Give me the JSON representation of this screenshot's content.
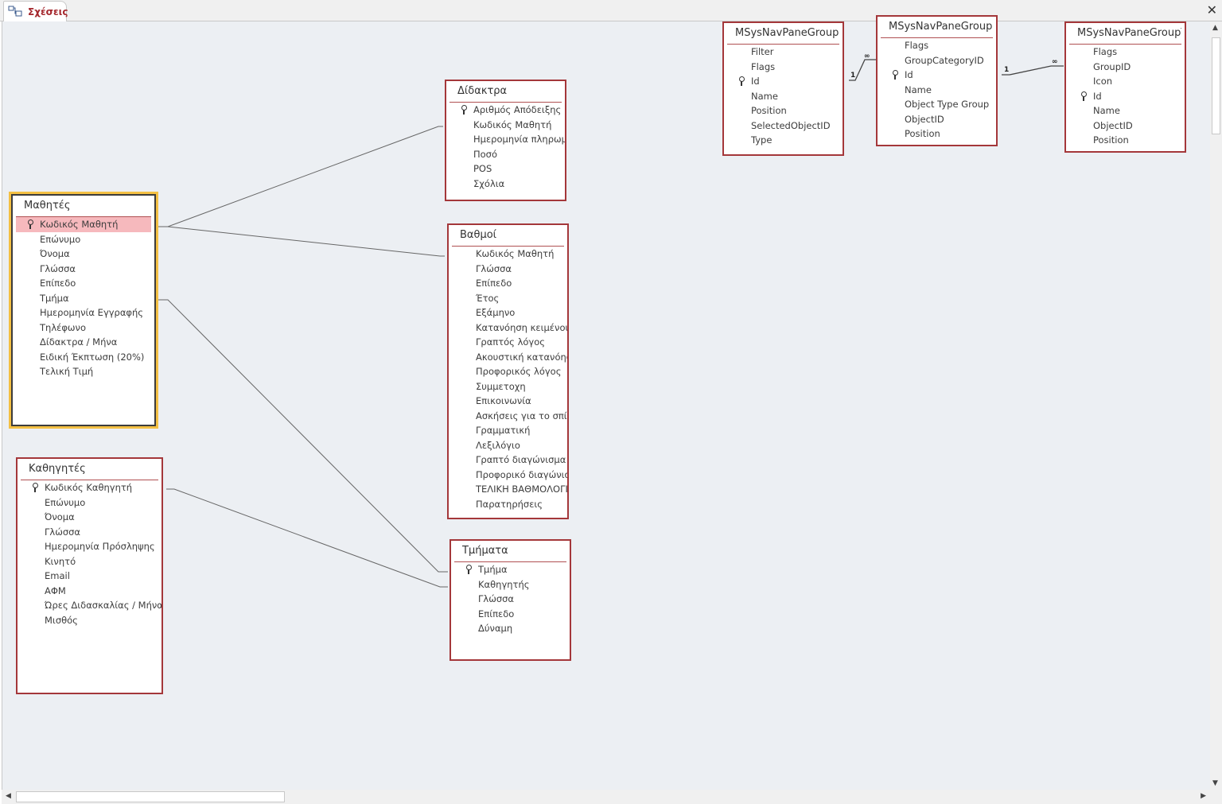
{
  "tab": {
    "label": "Σχέσεις"
  },
  "tables": {
    "mathites": {
      "title": "Μαθητές",
      "fields": [
        "Κωδικός Μαθητή",
        "Επώνυμο",
        "Όνομα",
        "Γλώσσα",
        "Επίπεδο",
        "Τμήμα",
        "Ημερομηνία Εγγραφής",
        "Τηλέφωνο",
        "Δίδακτρα / Μήνα",
        "Ειδική Έκπτωση (20%)",
        "Τελική Τιμή"
      ]
    },
    "kathigites": {
      "title": "Καθηγητές",
      "fields": [
        "Κωδικός Καθηγητή",
        "Επώνυμο",
        "Όνομα",
        "Γλώσσα",
        "Ημερομηνία Πρόσληψης",
        "Κινητό",
        "Email",
        "ΑΦΜ",
        "Ώρες Διδασκαλίας / Μήνα",
        "Μισθός"
      ]
    },
    "didaktra": {
      "title": "Δίδακτρα",
      "fields": [
        "Αριθμός Απόδειξης",
        "Κωδικός Μαθητή",
        "Ημερομηνία πληρωμής",
        "Ποσό",
        "POS",
        "Σχόλια"
      ]
    },
    "vathmoi": {
      "title": "Βαθμοί",
      "fields": [
        "Κωδικός Μαθητή",
        "Γλώσσα",
        "Επίπεδο",
        "Έτος",
        "Εξάμηνο",
        "Κατανόηση κειμένου",
        "Γραπτός λόγος",
        "Ακουστική κατανόηση",
        "Προφορικός λόγος",
        "Συμμετοχη",
        "Επικοινωνία",
        "Ασκήσεις για το σπίτι",
        "Γραμματική",
        "Λεξιλόγιο",
        "Γραπτό διαγώνισμα",
        "Προφορικό διαγώνισμα",
        "ΤΕΛΙΚΗ ΒΑΘΜΟΛΟΓΙΑ",
        "Παρατηρήσεις"
      ]
    },
    "tmimata": {
      "title": "Τμήματα",
      "fields": [
        "Τμήμα",
        "Καθηγητής",
        "Γλώσσα",
        "Επίπεδο",
        "Δύναμη"
      ]
    },
    "msys_c": {
      "title": "MSysNavPaneGroupC...",
      "fields": [
        "Filter",
        "Flags",
        "Id",
        "Name",
        "Position",
        "SelectedObjectID",
        "Type"
      ]
    },
    "msys_groups": {
      "title": "MSysNavPaneGroups",
      "fields": [
        "Flags",
        "GroupCategoryID",
        "Id",
        "Name",
        "Object Type Group",
        "ObjectID",
        "Position"
      ]
    },
    "msys_t": {
      "title": "MSysNavPaneGroupT...",
      "fields": [
        "Flags",
        "GroupID",
        "Icon",
        "Id",
        "Name",
        "ObjectID",
        "Position"
      ]
    }
  },
  "relationships": {
    "one_label": "1",
    "many_label": "∞"
  },
  "colors": {
    "table_border": "#a4373a",
    "selected_outline": "#f4c044",
    "highlight_row": "#f6b9bd",
    "canvas": "#eceff3"
  }
}
